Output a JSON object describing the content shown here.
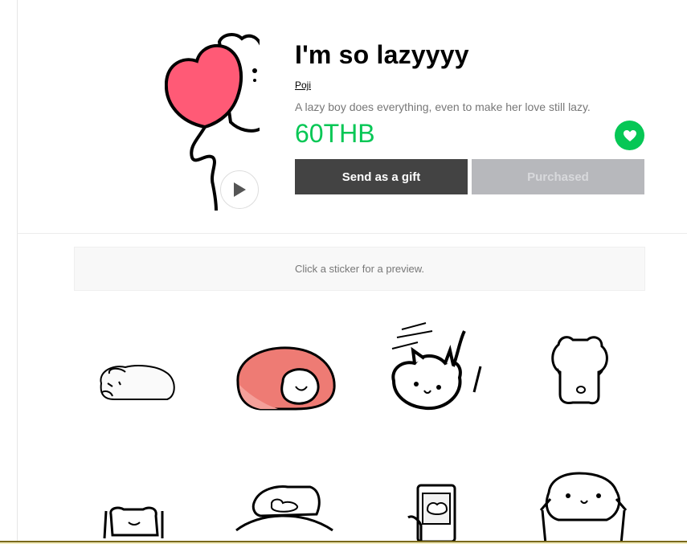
{
  "product": {
    "title": "I'm so lazyyyy",
    "author": "Poji",
    "description": "A lazy boy does everything, even to make her love still lazy.",
    "price": "60THB"
  },
  "buttons": {
    "gift_label": "Send as a gift",
    "purchased_label": "Purchased"
  },
  "preview": {
    "hint": "Click a sticker for a preview."
  },
  "icons": {
    "play": "play-icon",
    "favorite": "heart-icon"
  },
  "colors": {
    "accent": "#06c755",
    "gift_button": "#434343",
    "purchased_button": "#b7b8bc",
    "heart": "#ff5a76",
    "blanket": "#ee7b74"
  }
}
